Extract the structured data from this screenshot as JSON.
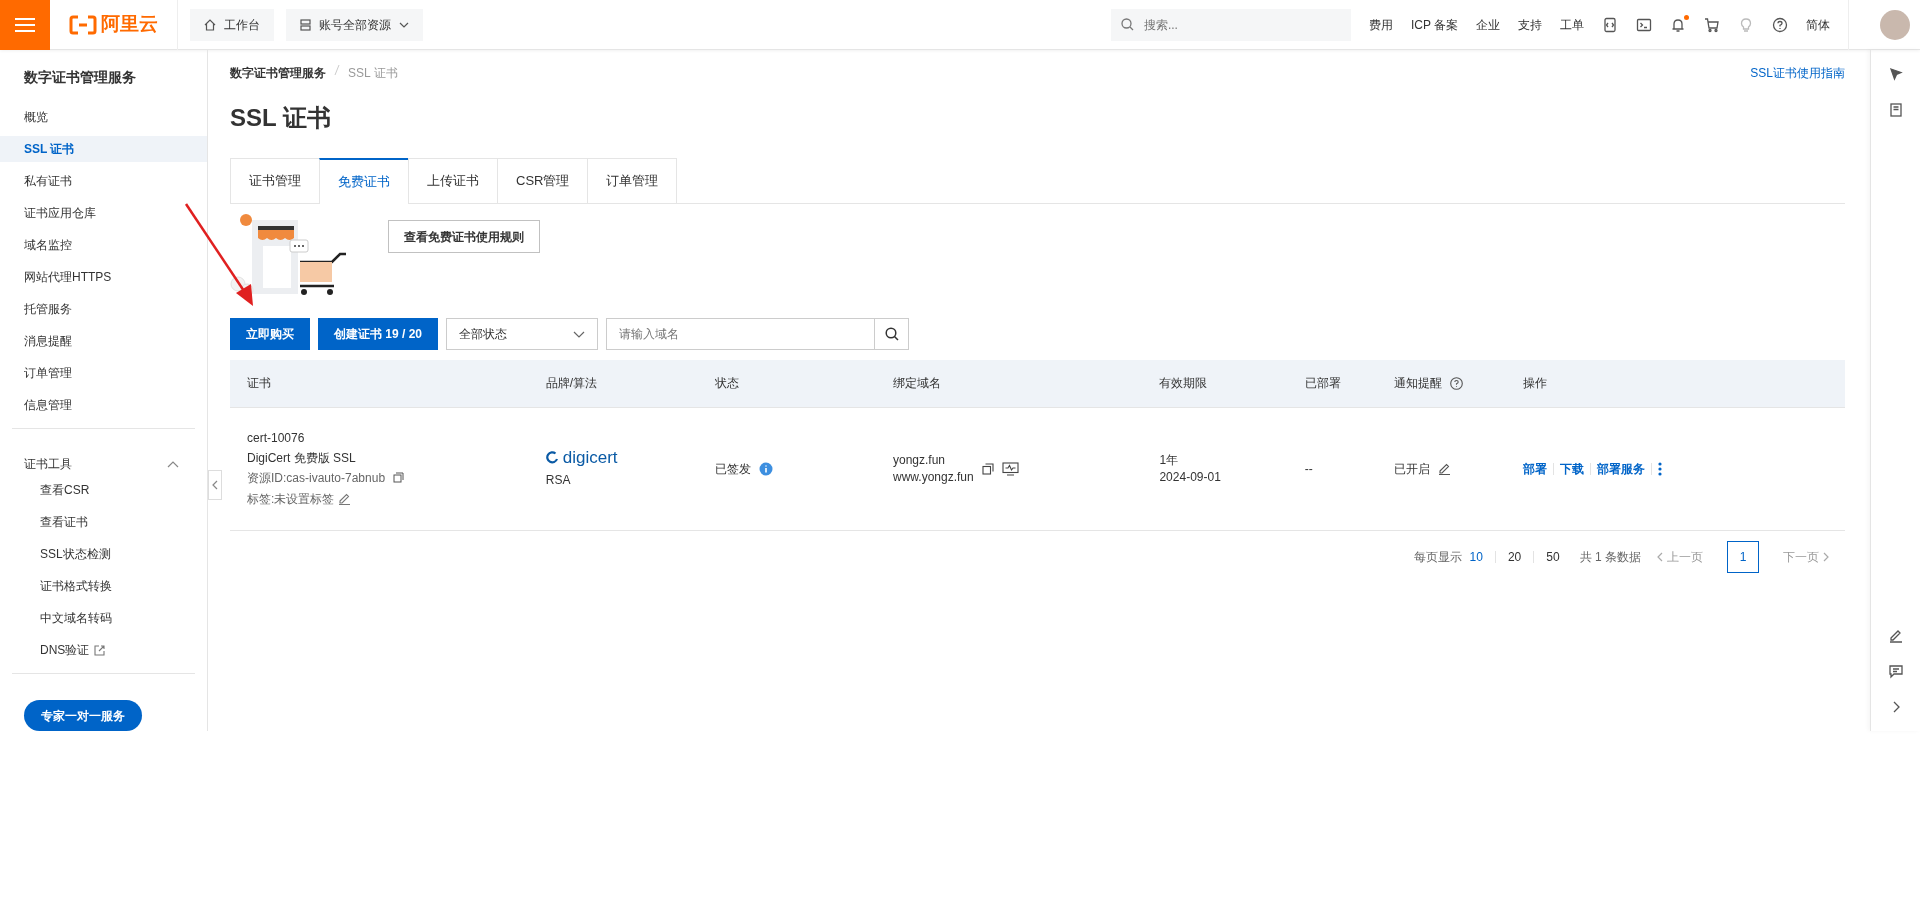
{
  "topbar": {
    "logo_text": "阿里云",
    "workbench": "工作台",
    "resources": "账号全部资源",
    "search_placeholder": "搜索...",
    "links": [
      "费用",
      "ICP 备案",
      "企业",
      "支持",
      "工单"
    ],
    "bell_unread": true,
    "language": "简体"
  },
  "sidebar": {
    "title": "数字证书管理服务",
    "items": [
      {
        "label": "概览",
        "selected": false
      },
      {
        "label": "SSL 证书",
        "selected": true
      },
      {
        "label": "私有证书",
        "selected": false
      },
      {
        "label": "证书应用仓库",
        "selected": false
      },
      {
        "label": "域名监控",
        "selected": false
      },
      {
        "label": "网站代理HTTPS",
        "selected": false
      },
      {
        "label": "托管服务",
        "selected": false
      },
      {
        "label": "消息提醒",
        "selected": false
      },
      {
        "label": "订单管理",
        "selected": false
      },
      {
        "label": "信息管理",
        "selected": false
      }
    ],
    "tools": {
      "label": "证书工具",
      "expanded": true,
      "items": [
        {
          "label": "查看CSR",
          "external": false
        },
        {
          "label": "查看证书",
          "external": false
        },
        {
          "label": "SSL状态检测",
          "external": false
        },
        {
          "label": "证书格式转换",
          "external": false
        },
        {
          "label": "中文域名转码",
          "external": false
        },
        {
          "label": "DNS验证",
          "external": true
        }
      ]
    },
    "expert_button": "专家一对一服务"
  },
  "breadcrumb": [
    "数字证书管理服务",
    "SSL 证书"
  ],
  "guide_link": "SSL证书使用指南",
  "title": "SSL 证书",
  "tabs": [
    {
      "label": "证书管理",
      "selected": false
    },
    {
      "label": "免费证书",
      "selected": true
    },
    {
      "label": "上传证书",
      "selected": false
    },
    {
      "label": "CSR管理",
      "selected": false
    },
    {
      "label": "订单管理",
      "selected": false
    }
  ],
  "rules_button": "查看免费证书使用规则",
  "buy_button": "立即购买",
  "create_button": "创建证书 19 / 20",
  "status_select": "全部状态",
  "domain_search": {
    "placeholder": "请输入域名"
  },
  "table": {
    "columns": [
      "证书",
      "品牌/算法",
      "状态",
      "绑定域名",
      "有效期限",
      "已部署",
      "通知提醒",
      "操作"
    ],
    "rows": [
      {
        "cert_id": "cert-10076",
        "product": "DigiCert 免费版 SSL",
        "resource_id": "资源ID:cas-ivauto-7abnub",
        "tag": "标签:未设置标签",
        "brand": "digicert",
        "algorithm": "RSA",
        "status": "已签发",
        "domains": [
          "yongz.fun",
          "www.yongz.fun"
        ],
        "validity": "1年",
        "expiry": "2024-09-01",
        "deployed": "--",
        "notify": "已开启",
        "actions": [
          "部署",
          "下载",
          "部署服务"
        ]
      }
    ]
  },
  "pagination": {
    "label": "每页显示",
    "sizes": [
      {
        "label": "10",
        "selected": true
      },
      {
        "label": "20",
        "selected": false
      },
      {
        "label": "50",
        "selected": false
      }
    ],
    "total": "共 1 条数据",
    "prev": "上一页",
    "pages": [
      {
        "label": "1",
        "selected": true
      }
    ],
    "next": "下一页"
  }
}
